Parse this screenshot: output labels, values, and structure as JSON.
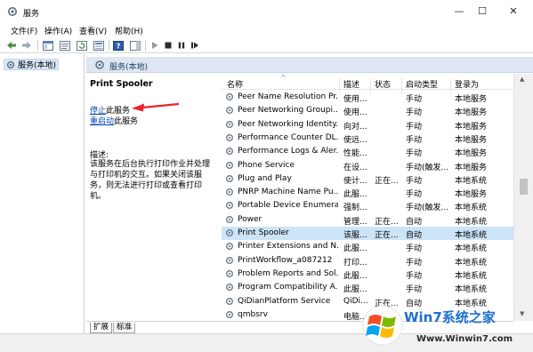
{
  "window": {
    "title": "服务",
    "minimize_glyph": "—",
    "maximize_glyph": "☐",
    "close_glyph": "✕"
  },
  "menu": [
    "文件(F)",
    "操作(A)",
    "查看(V)",
    "帮助(H)"
  ],
  "toolbar": {
    "icons": [
      "back-icon",
      "forward-icon",
      "console-tree-icon",
      "properties-icon",
      "refresh-icon",
      "export-list-icon",
      "help-icon",
      "show-hide-icon",
      "start-service-icon",
      "stop-service-icon",
      "pause-service-icon",
      "restart-service-icon"
    ]
  },
  "tree": {
    "root_label": "服务(本地)"
  },
  "pane": {
    "header_label": "服务(本地)"
  },
  "details": {
    "service_name": "Print Spooler",
    "stop_link": "停止",
    "stop_suffix": "此服务",
    "restart_link": "重启动",
    "restart_suffix": "此服务",
    "description_label": "描述:",
    "description_text": "该服务在后台执行打印作业并处理与打印机的交互。如果关闭该服务，则无法进行打印或查看打印机。"
  },
  "table": {
    "columns": [
      "名称",
      "描述",
      "状态",
      "启动类型",
      "登录为"
    ],
    "sort_indicator": "^",
    "rows": [
      {
        "name": "Peer Name Resolution Pr...",
        "desc": "使用...",
        "status": "",
        "startup": "手动",
        "logon": "本地服务"
      },
      {
        "name": "Peer Networking Groupi...",
        "desc": "使用...",
        "status": "",
        "startup": "手动",
        "logon": "本地服务"
      },
      {
        "name": "Peer Networking Identity...",
        "desc": "向对...",
        "status": "",
        "startup": "手动",
        "logon": "本地服务"
      },
      {
        "name": "Performance Counter DL...",
        "desc": "使远...",
        "status": "",
        "startup": "手动",
        "logon": "本地服务"
      },
      {
        "name": "Performance Logs & Aler...",
        "desc": "性能...",
        "status": "",
        "startup": "手动",
        "logon": "本地服务"
      },
      {
        "name": "Phone Service",
        "desc": "在设...",
        "status": "",
        "startup": "手动(触发...",
        "logon": "本地服务"
      },
      {
        "name": "Plug and Play",
        "desc": "使计...",
        "status": "正在...",
        "startup": "手动",
        "logon": "本地系统"
      },
      {
        "name": "PNRP Machine Name Pu...",
        "desc": "此服...",
        "status": "",
        "startup": "手动",
        "logon": "本地服务"
      },
      {
        "name": "Portable Device Enumera...",
        "desc": "强制...",
        "status": "",
        "startup": "手动(触发...",
        "logon": "本地系统"
      },
      {
        "name": "Power",
        "desc": "管理...",
        "status": "正在...",
        "startup": "自动",
        "logon": "本地系统"
      },
      {
        "name": "Print Spooler",
        "desc": "该服...",
        "status": "正在...",
        "startup": "自动",
        "logon": "本地系统"
      },
      {
        "name": "Printer Extensions and N...",
        "desc": "此服...",
        "status": "",
        "startup": "手动",
        "logon": "本地系统"
      },
      {
        "name": "PrintWorkflow_a087212",
        "desc": "打印...",
        "status": "",
        "startup": "手动",
        "logon": "本地系统"
      },
      {
        "name": "Problem Reports and Sol...",
        "desc": "此服...",
        "status": "",
        "startup": "手动",
        "logon": "本地系统"
      },
      {
        "name": "Program Compatibility A...",
        "desc": "此服...",
        "status": "",
        "startup": "手动",
        "logon": "本地系统"
      },
      {
        "name": "QiDianPlatform Service",
        "desc": "QiDi...",
        "status": "正在...",
        "startup": "自动",
        "logon": "本地系统"
      },
      {
        "name": "qmbsrv",
        "desc": "电脑...",
        "status": "",
        "startup": "",
        "logon": ""
      }
    ],
    "selected_row_index": 10
  },
  "tabs": [
    "扩展",
    "标准"
  ],
  "watermark": {
    "brand": "Win7系统之家",
    "url": "Www.Winwin7.com"
  },
  "colors": {
    "accent": "#0645ad",
    "selection": "#cce4f7",
    "arrow": "#e5262b",
    "pane_header": "#dde6f2"
  }
}
